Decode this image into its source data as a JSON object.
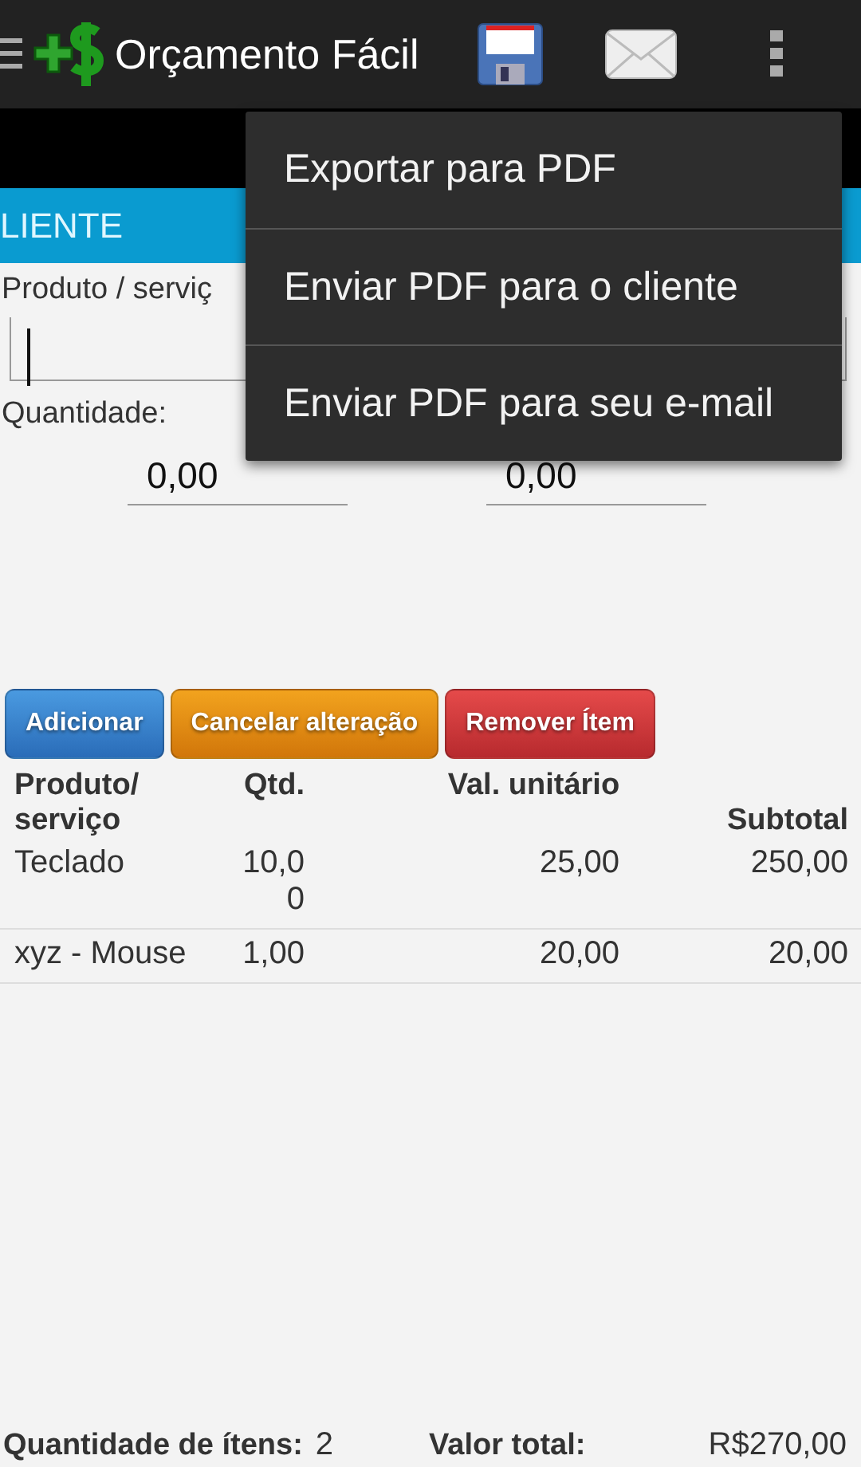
{
  "app_bar": {
    "title": "Orçamento Fácil"
  },
  "tabs": [
    {
      "label": "LIENTE",
      "selected": true
    }
  ],
  "form": {
    "product_label": "Produto / serviç",
    "quantity_label": "Quantidade:",
    "quantity_value": "0,00",
    "price_value": "0,00"
  },
  "buttons": [
    {
      "label": "Adicionar",
      "kind": "blue"
    },
    {
      "label": "Cancelar alteração",
      "kind": "orange"
    },
    {
      "label": "Remover Ítem",
      "kind": "red"
    }
  ],
  "table": {
    "columns": [
      "Produto/ serviço",
      "Qtd.",
      "Val. unitário",
      "Subtotal"
    ],
    "rows": [
      [
        "Teclado",
        "10,00",
        "25,00",
        "250,00"
      ],
      [
        "xyz - Mouse",
        "1,00",
        "20,00",
        "20,00"
      ]
    ]
  },
  "footer": {
    "count_label": "Quantidade de ítens:",
    "count": "2",
    "total_label": "Valor total:",
    "total": "R$270,00"
  },
  "menu": {
    "items": [
      "Exportar para PDF",
      "Enviar PDF para o cliente",
      "Enviar PDF para seu e-mail"
    ]
  }
}
